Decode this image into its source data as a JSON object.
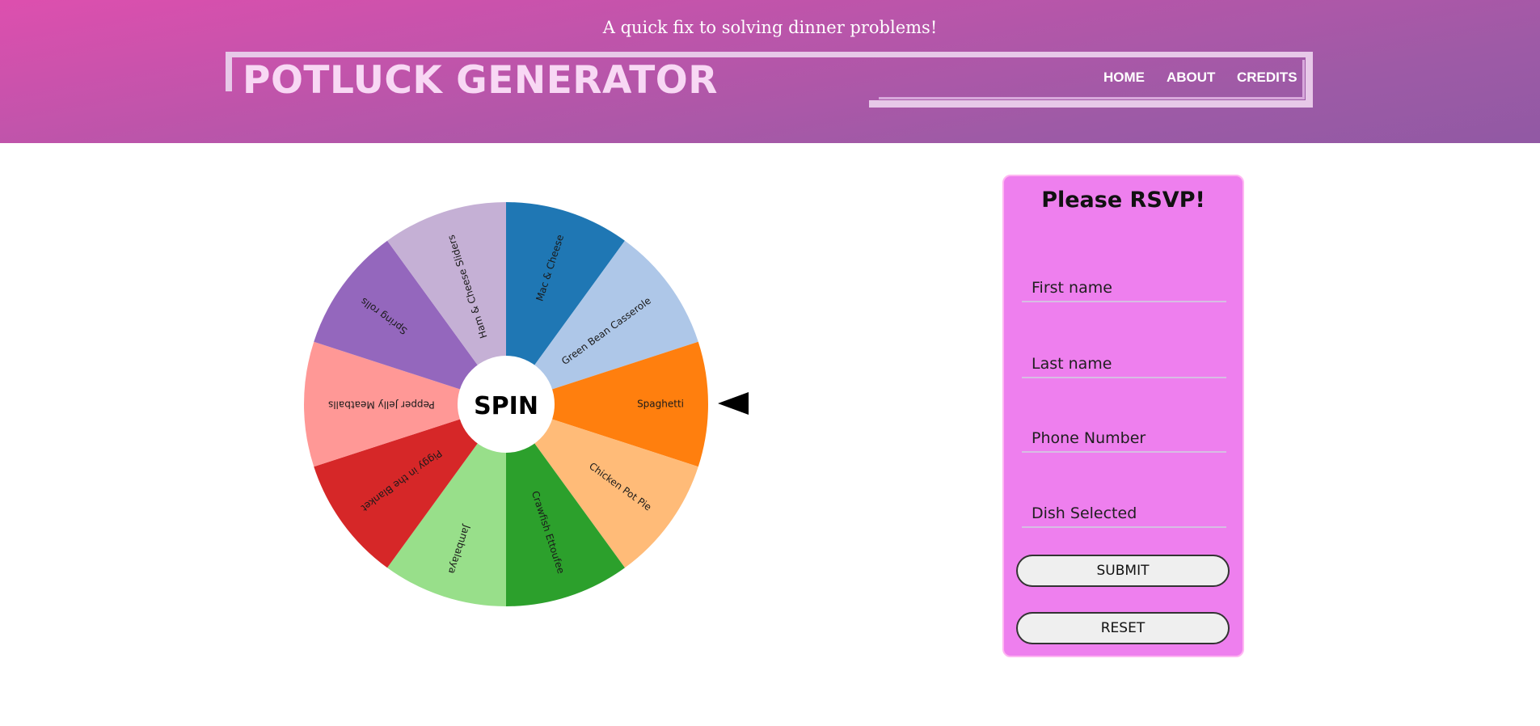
{
  "header": {
    "tagline": "A quick fix to solving dinner problems!",
    "site_title": "POTLUCK GENERATOR",
    "nav": [
      "HOME",
      "ABOUT",
      "CREDITS"
    ]
  },
  "wheel": {
    "center_label": "SPIN",
    "selected": "Spaghetti",
    "slices": [
      {
        "label": "Mac & Cheese",
        "color": "#1f77b4"
      },
      {
        "label": "Green Bean Casserole",
        "color": "#aec7e8"
      },
      {
        "label": "Spaghetti",
        "color": "#ff7f0e"
      },
      {
        "label": "Chicken Pot Pie",
        "color": "#ffbb78"
      },
      {
        "label": "Crawfish Ettoufee",
        "color": "#2ca02c"
      },
      {
        "label": "Jambalaya",
        "color": "#98df8a"
      },
      {
        "label": "Piggy in the Blanket",
        "color": "#d62728"
      },
      {
        "label": "Pepper Jelly Meatballs",
        "color": "#ff9896"
      },
      {
        "label": "Spring rolls",
        "color": "#9467bd"
      },
      {
        "label": "Ham & Cheese Sliders",
        "color": "#c5b0d5"
      }
    ]
  },
  "rsvp": {
    "title": "Please RSVP!",
    "fields": {
      "first_name": "First name",
      "last_name": "Last name",
      "phone": "Phone Number",
      "dish": "Dish Selected"
    },
    "submit_label": "SUBMIT",
    "reset_label": "RESET"
  },
  "colors": {
    "header_start": "#dd4fae",
    "header_end": "#9159a4",
    "rsvp_background": "#ee7fee",
    "title_color": "#f8d8f4"
  }
}
